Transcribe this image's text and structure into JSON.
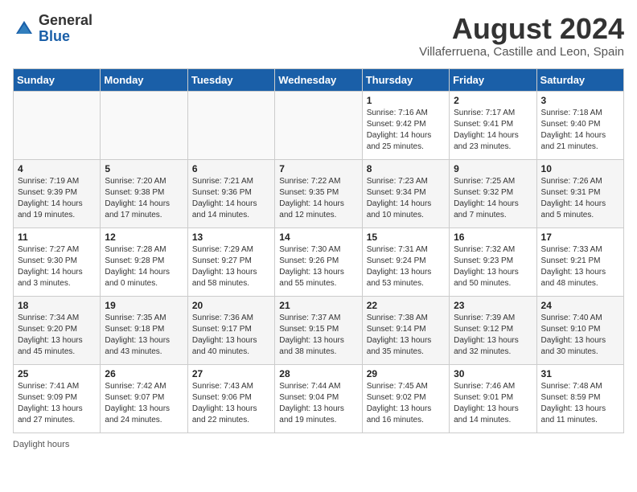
{
  "logo": {
    "general": "General",
    "blue": "Blue"
  },
  "title": "August 2024",
  "subtitle": "Villaferruena, Castille and Leon, Spain",
  "headers": [
    "Sunday",
    "Monday",
    "Tuesday",
    "Wednesday",
    "Thursday",
    "Friday",
    "Saturday"
  ],
  "footer": {
    "daylight_label": "Daylight hours"
  },
  "weeks": [
    [
      {
        "day": "",
        "info": ""
      },
      {
        "day": "",
        "info": ""
      },
      {
        "day": "",
        "info": ""
      },
      {
        "day": "",
        "info": ""
      },
      {
        "day": "1",
        "info": "Sunrise: 7:16 AM\nSunset: 9:42 PM\nDaylight: 14 hours\nand 25 minutes."
      },
      {
        "day": "2",
        "info": "Sunrise: 7:17 AM\nSunset: 9:41 PM\nDaylight: 14 hours\nand 23 minutes."
      },
      {
        "day": "3",
        "info": "Sunrise: 7:18 AM\nSunset: 9:40 PM\nDaylight: 14 hours\nand 21 minutes."
      }
    ],
    [
      {
        "day": "4",
        "info": "Sunrise: 7:19 AM\nSunset: 9:39 PM\nDaylight: 14 hours\nand 19 minutes."
      },
      {
        "day": "5",
        "info": "Sunrise: 7:20 AM\nSunset: 9:38 PM\nDaylight: 14 hours\nand 17 minutes."
      },
      {
        "day": "6",
        "info": "Sunrise: 7:21 AM\nSunset: 9:36 PM\nDaylight: 14 hours\nand 14 minutes."
      },
      {
        "day": "7",
        "info": "Sunrise: 7:22 AM\nSunset: 9:35 PM\nDaylight: 14 hours\nand 12 minutes."
      },
      {
        "day": "8",
        "info": "Sunrise: 7:23 AM\nSunset: 9:34 PM\nDaylight: 14 hours\nand 10 minutes."
      },
      {
        "day": "9",
        "info": "Sunrise: 7:25 AM\nSunset: 9:32 PM\nDaylight: 14 hours\nand 7 minutes."
      },
      {
        "day": "10",
        "info": "Sunrise: 7:26 AM\nSunset: 9:31 PM\nDaylight: 14 hours\nand 5 minutes."
      }
    ],
    [
      {
        "day": "11",
        "info": "Sunrise: 7:27 AM\nSunset: 9:30 PM\nDaylight: 14 hours\nand 3 minutes."
      },
      {
        "day": "12",
        "info": "Sunrise: 7:28 AM\nSunset: 9:28 PM\nDaylight: 14 hours\nand 0 minutes."
      },
      {
        "day": "13",
        "info": "Sunrise: 7:29 AM\nSunset: 9:27 PM\nDaylight: 13 hours\nand 58 minutes."
      },
      {
        "day": "14",
        "info": "Sunrise: 7:30 AM\nSunset: 9:26 PM\nDaylight: 13 hours\nand 55 minutes."
      },
      {
        "day": "15",
        "info": "Sunrise: 7:31 AM\nSunset: 9:24 PM\nDaylight: 13 hours\nand 53 minutes."
      },
      {
        "day": "16",
        "info": "Sunrise: 7:32 AM\nSunset: 9:23 PM\nDaylight: 13 hours\nand 50 minutes."
      },
      {
        "day": "17",
        "info": "Sunrise: 7:33 AM\nSunset: 9:21 PM\nDaylight: 13 hours\nand 48 minutes."
      }
    ],
    [
      {
        "day": "18",
        "info": "Sunrise: 7:34 AM\nSunset: 9:20 PM\nDaylight: 13 hours\nand 45 minutes."
      },
      {
        "day": "19",
        "info": "Sunrise: 7:35 AM\nSunset: 9:18 PM\nDaylight: 13 hours\nand 43 minutes."
      },
      {
        "day": "20",
        "info": "Sunrise: 7:36 AM\nSunset: 9:17 PM\nDaylight: 13 hours\nand 40 minutes."
      },
      {
        "day": "21",
        "info": "Sunrise: 7:37 AM\nSunset: 9:15 PM\nDaylight: 13 hours\nand 38 minutes."
      },
      {
        "day": "22",
        "info": "Sunrise: 7:38 AM\nSunset: 9:14 PM\nDaylight: 13 hours\nand 35 minutes."
      },
      {
        "day": "23",
        "info": "Sunrise: 7:39 AM\nSunset: 9:12 PM\nDaylight: 13 hours\nand 32 minutes."
      },
      {
        "day": "24",
        "info": "Sunrise: 7:40 AM\nSunset: 9:10 PM\nDaylight: 13 hours\nand 30 minutes."
      }
    ],
    [
      {
        "day": "25",
        "info": "Sunrise: 7:41 AM\nSunset: 9:09 PM\nDaylight: 13 hours\nand 27 minutes."
      },
      {
        "day": "26",
        "info": "Sunrise: 7:42 AM\nSunset: 9:07 PM\nDaylight: 13 hours\nand 24 minutes."
      },
      {
        "day": "27",
        "info": "Sunrise: 7:43 AM\nSunset: 9:06 PM\nDaylight: 13 hours\nand 22 minutes."
      },
      {
        "day": "28",
        "info": "Sunrise: 7:44 AM\nSunset: 9:04 PM\nDaylight: 13 hours\nand 19 minutes."
      },
      {
        "day": "29",
        "info": "Sunrise: 7:45 AM\nSunset: 9:02 PM\nDaylight: 13 hours\nand 16 minutes."
      },
      {
        "day": "30",
        "info": "Sunrise: 7:46 AM\nSunset: 9:01 PM\nDaylight: 13 hours\nand 14 minutes."
      },
      {
        "day": "31",
        "info": "Sunrise: 7:48 AM\nSunset: 8:59 PM\nDaylight: 13 hours\nand 11 minutes."
      }
    ]
  ]
}
